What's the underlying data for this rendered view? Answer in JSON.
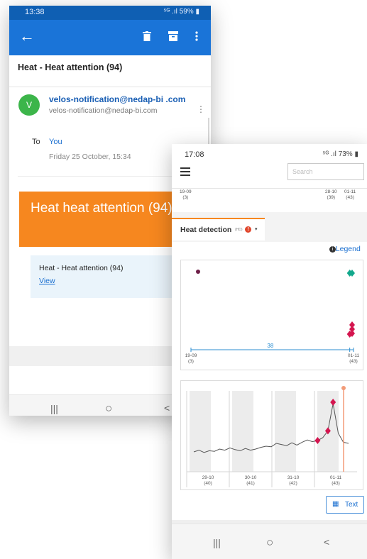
{
  "email_phone": {
    "status": {
      "time": "13:38",
      "battery": "59%",
      "signal_icons": "⁵ᴳ .ıl"
    },
    "toolbar": {
      "back_icon": "arrow-left-icon",
      "actions": [
        "trash-icon",
        "archive-icon",
        "more-vert-icon"
      ]
    },
    "subject": "Heat - Heat attention (94)",
    "sender": {
      "avatar_letter": "V",
      "avatar_color": "#3cb54a",
      "name": "velos-notification@nedap-bi .com",
      "address": "velos-notification@nedap-bi.com"
    },
    "to": {
      "label": "To",
      "value": "You"
    },
    "date": "Friday 25 October, 15:34",
    "banner": {
      "text": "Heat heat attention (94)",
      "color": "#f6871f"
    },
    "card": {
      "title": "Heat - Heat attention (94)",
      "link": "View"
    },
    "nav": {
      "recent": "|||",
      "home": "○",
      "back": "<"
    }
  },
  "heat_phone": {
    "status": {
      "time": "17:08",
      "battery": "73%",
      "signal_icons": "⁵ᴳ .ıl"
    },
    "search": {
      "placeholder": "Search"
    },
    "top_axis": {
      "left": {
        "date": "19-09",
        "num": "(3)"
      },
      "mid": {
        "date": "28-10",
        "num": "(39)"
      },
      "right": {
        "date": "01-11",
        "num": "(43)"
      }
    },
    "tab": {
      "label": "Heat detection",
      "small": "(HD)",
      "info_icon": "info-icon",
      "caret": "▾"
    },
    "legend": {
      "label": "Legend",
      "icon": "info-icon"
    },
    "chart_data": [
      {
        "type": "scatter",
        "title": "",
        "x_labels": [
          {
            "date": "19-09",
            "num": "(3)"
          },
          {
            "date": "01-11",
            "num": "(43)"
          }
        ],
        "interval_label": "38",
        "points": [
          {
            "x": "19-09",
            "kind": "circle",
            "color": "#6e1f48"
          },
          {
            "x": "31-10",
            "kind": "diamond",
            "color": "#12a88c"
          },
          {
            "x": "01-11",
            "kind": "diamond",
            "color": "#12a88c"
          },
          {
            "x": "31-10",
            "kind": "diamond",
            "color": "#d4154f"
          },
          {
            "x": "01-11",
            "kind": "diamond",
            "color": "#d4154f"
          },
          {
            "x": "01-11",
            "kind": "diamond",
            "color": "#d4154f"
          },
          {
            "x": "01-11",
            "kind": "diamond",
            "color": "#d4154f"
          }
        ]
      },
      {
        "type": "line",
        "title": "",
        "x_labels": [
          {
            "date": "29-10",
            "num": "(40)"
          },
          {
            "date": "30-10",
            "num": "(41)"
          },
          {
            "date": "31-10",
            "num": "(42)"
          },
          {
            "date": "01-11",
            "num": "(43)"
          }
        ],
        "series": [
          {
            "values": [
              0.15,
              0.18,
              0.14,
              0.17,
              0.16,
              0.2,
              0.18,
              0.22,
              0.19,
              0.17,
              0.21,
              0.18,
              0.2,
              0.23,
              0.25,
              0.24,
              0.3,
              0.28,
              0.26,
              0.31,
              0.27,
              0.32,
              0.36,
              0.33,
              0.35,
              0.4,
              0.52,
              1.0,
              0.48,
              0.32,
              0.3
            ]
          }
        ],
        "markers": [
          {
            "index": 27,
            "color": "#d4154f"
          },
          {
            "index": 24,
            "color": "#d4154f"
          },
          {
            "index": 26,
            "color": "#d4154f"
          }
        ],
        "now_line_color": "#f29b78"
      }
    ],
    "text_button": {
      "icon": "table-icon",
      "label": "Text"
    },
    "nav": {
      "recent": "|||",
      "home": "○",
      "back": "<"
    }
  }
}
